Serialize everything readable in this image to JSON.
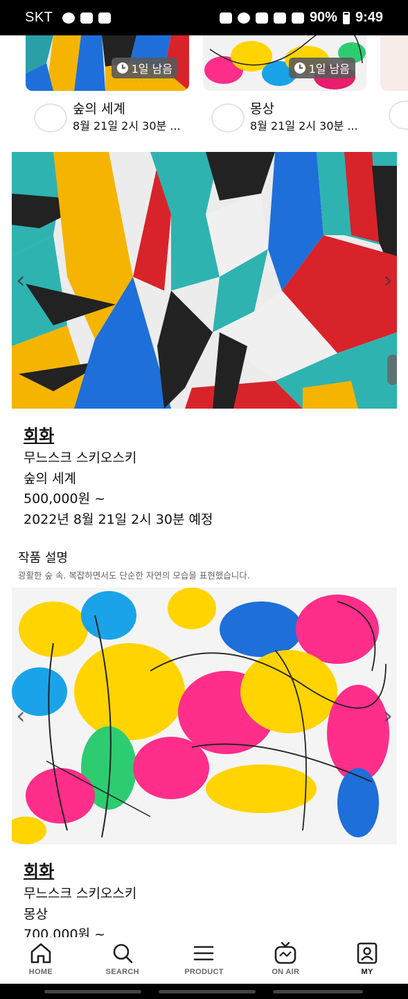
{
  "status_bar": {
    "carrier": "SKT",
    "battery": "90%",
    "time": "9:49"
  },
  "top_cards": [
    {
      "title": "숲의 세계",
      "date": "8월 21일 2시 30분 ...",
      "badge": "1일 남음"
    },
    {
      "title": "몽상",
      "date": "8월 21일 2시 30분 ...",
      "badge": "1일 남음"
    }
  ],
  "artworks": [
    {
      "category": "회화",
      "artist": "무느스크 스키오스키",
      "title": "숲의 세계",
      "price": "500,000원 ~",
      "schedule": "2022년 8월 21일 2시 30분 예정"
    },
    {
      "category": "회화",
      "artist": "무느스크 스키오스키",
      "title": "몽상",
      "price": "700,000원 ~"
    }
  ],
  "description": {
    "title": "작품 설명",
    "text": "광활한 숲 속. 복잡하면서도 단순한 자연의 모습을 표현했습니다."
  },
  "carousel_arrows": {
    "prev": "‹",
    "next": "›"
  },
  "bottom_nav": [
    {
      "label": "HOME",
      "icon": "home-icon"
    },
    {
      "label": "SEARCH",
      "icon": "search-icon"
    },
    {
      "label": "PRODUCT",
      "icon": "menu-icon"
    },
    {
      "label": "ON AIR",
      "icon": "tv-icon"
    },
    {
      "label": "MY",
      "icon": "profile-icon"
    }
  ]
}
